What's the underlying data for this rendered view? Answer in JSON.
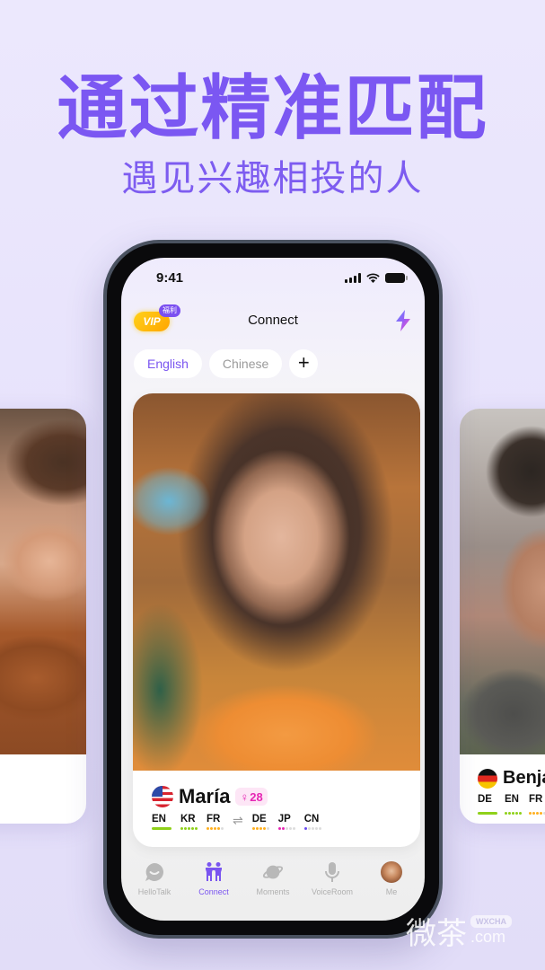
{
  "headline": "通过精准匹配",
  "subheadline": "遇见兴趣相投的人",
  "status_bar": {
    "time": "9:41"
  },
  "header": {
    "vip_label": "VIP",
    "vip_tag": "福利",
    "title": "Connect"
  },
  "language_tabs": {
    "items": [
      {
        "label": "English",
        "active": true
      },
      {
        "label": "Chinese",
        "active": false
      }
    ],
    "add_label": "+"
  },
  "main_card": {
    "name": "María",
    "country": "US",
    "gender_symbol": "♀",
    "age": "28",
    "native_languages": [
      {
        "code": "EN",
        "level": 5,
        "color": "#8fd11a",
        "native": true
      },
      {
        "code": "KR",
        "level": 5,
        "color": "#8fd11a"
      },
      {
        "code": "FR",
        "level": 4,
        "color": "#ffb020"
      }
    ],
    "swap_symbol": "⇌",
    "learning_languages": [
      {
        "code": "DE",
        "level": 4,
        "color": "#ffb020"
      },
      {
        "code": "JP",
        "level": 2,
        "color": "#e627b4"
      },
      {
        "code": "CN",
        "level": 1,
        "color": "#6a4cf0"
      }
    ]
  },
  "right_card": {
    "name": "Benja",
    "country": "DE",
    "languages": [
      {
        "code": "DE",
        "level": 5,
        "color": "#8fd11a",
        "native": true
      },
      {
        "code": "EN",
        "level": 5,
        "color": "#8fd11a"
      },
      {
        "code": "FR",
        "level": 4,
        "color": "#ffb020"
      }
    ]
  },
  "tab_bar": {
    "items": [
      {
        "label": "HelloTalk",
        "icon": "chat-bubble-icon",
        "active": false
      },
      {
        "label": "Connect",
        "icon": "people-icon",
        "active": true
      },
      {
        "label": "Moments",
        "icon": "planet-icon",
        "active": false
      },
      {
        "label": "VoiceRoom",
        "icon": "microphone-icon",
        "active": false
      },
      {
        "label": "Me",
        "icon": "avatar",
        "active": false
      }
    ]
  },
  "watermark": {
    "chars": "微茶",
    "badge": "WXCHA",
    "domain": ".com"
  },
  "colors": {
    "accent": "#7a55f0",
    "headline": "#7b57f2",
    "vip": "#ffb800",
    "age_pink": "#e627b4"
  }
}
